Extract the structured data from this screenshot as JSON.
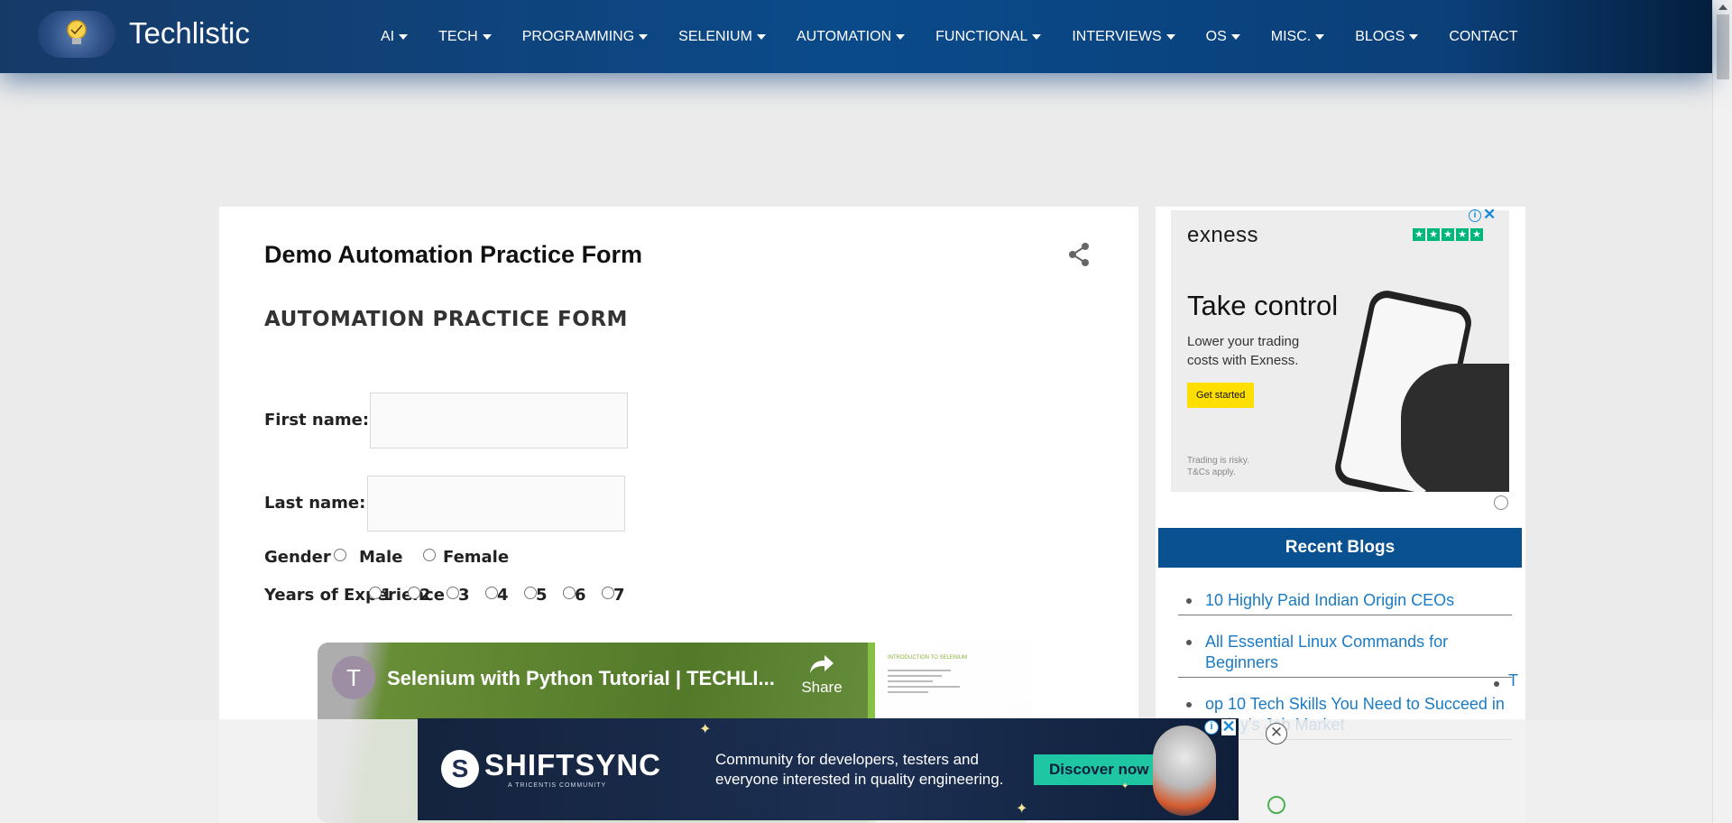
{
  "header": {
    "brand": "Techlistic",
    "nav": [
      {
        "label": "AI",
        "caret": true
      },
      {
        "label": "TECH",
        "caret": true
      },
      {
        "label": "PROGRAMMING",
        "caret": true
      },
      {
        "label": "SELENIUM",
        "caret": true
      },
      {
        "label": "AUTOMATION",
        "caret": true
      },
      {
        "label": "FUNCTIONAL",
        "caret": true
      },
      {
        "label": "INTERVIEWS",
        "caret": true
      },
      {
        "label": "OS",
        "caret": true
      },
      {
        "label": "MISC.",
        "caret": true
      },
      {
        "label": "BLOGS",
        "caret": true
      },
      {
        "label": "CONTACT",
        "caret": false
      }
    ]
  },
  "post": {
    "title": "Demo Automation Practice Form",
    "heading": "AUTOMATION PRACTICE FORM",
    "first_name_label": "First name:",
    "last_name_label": "Last name:",
    "first_name_value": "",
    "last_name_value": "",
    "gender_label": "Gender",
    "gender_options": [
      "Male",
      "Female"
    ],
    "experience_label": "Years of Experience",
    "experience_options": [
      "1",
      "2",
      "3",
      "4",
      "5",
      "6",
      "7"
    ]
  },
  "video": {
    "avatar_letter": "T",
    "title": "Selenium with Python Tutorial | TECHLI...",
    "share_label": "Share",
    "slide_title": "INTRODUCTION TO SELENIUM"
  },
  "sidebar": {
    "ad": {
      "brand": "exness",
      "headline": "Take control",
      "subtext": "Lower your trading costs with Exness.",
      "cta": "Get started",
      "disclaimer": "Trading is risky. T&Cs apply."
    },
    "recent_title": "Recent Blogs",
    "blogs": [
      "10 Highly Paid Indian Origin CEOs",
      "All Essential Linux Commands for Beginners",
      "op 10 Tech Skills You Need to Succeed in Today's Job Market"
    ],
    "overflow_letter": "T"
  },
  "bottom_ad": {
    "logo": "SHIFTSYNC",
    "tagline": "A TRICENTIS COMMUNITY",
    "text": "Community for developers, testers and everyone interested in quality engineering.",
    "cta": "Discover now"
  },
  "colors": {
    "header_blue": "#0a4a8a",
    "recent_bar": "#0a5191",
    "link": "#1a7bc4",
    "ad_button": "#ffde02",
    "shiftsync_button": "#1ec6a4"
  }
}
